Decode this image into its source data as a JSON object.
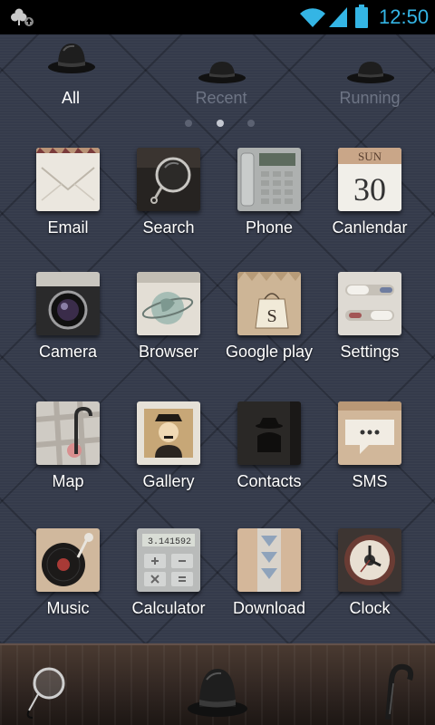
{
  "status_bar": {
    "time": "12:50",
    "notification_icon": "clover-update-icon",
    "wifi_icon": "wifi-icon",
    "signal_icon": "signal-icon",
    "battery_icon": "battery-icon",
    "accent": "#34b5e5"
  },
  "tabs": [
    {
      "label": "All",
      "active": true,
      "icon": "bowler-hat-icon"
    },
    {
      "label": "Recent",
      "active": false,
      "icon": "bowler-hat-icon"
    },
    {
      "label": "Running",
      "active": false,
      "icon": "bowler-hat-icon"
    }
  ],
  "pager": {
    "pages": 3,
    "current": 2
  },
  "apps": [
    {
      "label": "Email",
      "icon": "envelope-icon"
    },
    {
      "label": "Search",
      "icon": "magnifier-icon"
    },
    {
      "label": "Phone",
      "icon": "desk-phone-icon",
      "screen_text": "EGL-PASSLESS"
    },
    {
      "label": "Canlendar",
      "icon": "calendar-icon",
      "weekday": "SUN",
      "day": "30"
    },
    {
      "label": "Camera",
      "icon": "camera-icon"
    },
    {
      "label": "Browser",
      "icon": "globe-icon"
    },
    {
      "label": "Google play",
      "icon": "paper-bag-icon",
      "tag_letter": "S"
    },
    {
      "label": "Settings",
      "icon": "toggle-switches-icon"
    },
    {
      "label": "Map",
      "icon": "map-umbrella-icon"
    },
    {
      "label": "Gallery",
      "icon": "portrait-frame-icon"
    },
    {
      "label": "Contacts",
      "icon": "address-book-icon"
    },
    {
      "label": "SMS",
      "icon": "speech-bubble-icon"
    },
    {
      "label": "Music",
      "icon": "record-player-icon"
    },
    {
      "label": "Calculator",
      "icon": "calculator-icon",
      "display": "3.141592"
    },
    {
      "label": "Download",
      "icon": "download-box-icon"
    },
    {
      "label": "Clock",
      "icon": "wall-clock-icon"
    }
  ],
  "dock": [
    {
      "icon": "monocle-icon"
    },
    {
      "icon": "bowler-hat-icon"
    },
    {
      "icon": "umbrella-handle-icon"
    }
  ]
}
